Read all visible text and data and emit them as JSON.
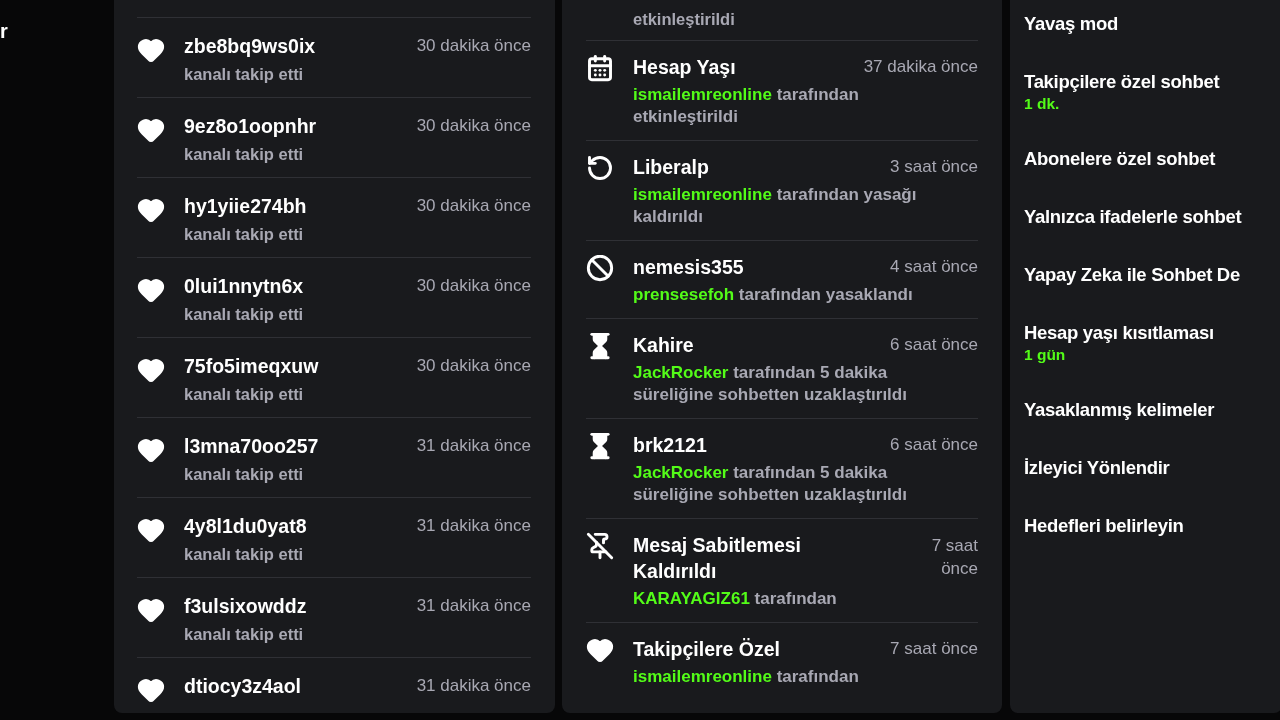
{
  "sidebar_fragment": "r",
  "followers": [
    {
      "name": "zbe8bq9ws0ix",
      "time": "30 dakika önce",
      "action": "kanalı takip etti"
    },
    {
      "name": "9ez8o1oopnhr",
      "time": "30 dakika önce",
      "action": "kanalı takip etti"
    },
    {
      "name": "hy1yiie274bh",
      "time": "30 dakika önce",
      "action": "kanalı takip etti"
    },
    {
      "name": "0lui1nnytn6x",
      "time": "30 dakika önce",
      "action": "kanalı takip etti"
    },
    {
      "name": "75fo5imeqxuw",
      "time": "30 dakika önce",
      "action": "kanalı takip etti"
    },
    {
      "name": "l3mna70oo257",
      "time": "31 dakika önce",
      "action": "kanalı takip etti"
    },
    {
      "name": "4y8l1du0yat8",
      "time": "31 dakika önce",
      "action": "kanalı takip etti"
    },
    {
      "name": "f3ulsixowddz",
      "time": "31 dakika önce",
      "action": "kanalı takip etti"
    },
    {
      "name": "dtiocy3z4aol",
      "time": "31 dakika önce"
    }
  ],
  "mod_log_fragment": "etkinleştirildi",
  "mod_log": [
    {
      "kind": "account_age",
      "title": "Hesap Yaşı",
      "time": "37 dakika önce",
      "actor": "ismailemreonline",
      "text": "tarafından etkinleştirildi"
    },
    {
      "kind": "unban",
      "title": "Liberalp",
      "time": "3 saat önce",
      "actor": "ismailemreonline",
      "text": "tarafından yasağı kaldırıldı"
    },
    {
      "kind": "ban",
      "title": "nemesis355",
      "time": "4 saat önce",
      "actor": "prensesefoh",
      "text": "tarafından yasaklandı"
    },
    {
      "kind": "timeout",
      "title": "Kahire",
      "time": "6 saat önce",
      "actor": "JackRocker",
      "text": "tarafından 5 dakika süreliğine sohbetten uzaklaştırıldı"
    },
    {
      "kind": "timeout",
      "title": "brk2121",
      "time": "6 saat önce",
      "actor": "JackRocker",
      "text": "tarafından 5 dakika süreliğine sohbetten uzaklaştırıldı"
    },
    {
      "kind": "unpin",
      "title": "Mesaj Sabitlemesi Kaldırıldı",
      "time": "7 saat önce",
      "actor": "KARAYAGIZ61",
      "text": "tarafından"
    },
    {
      "kind": "follow",
      "title": "Takipçilere Özel",
      "time": "7 saat önce",
      "actor": "ismailemreonline",
      "text": "tarafından"
    }
  ],
  "chat_settings": [
    {
      "label": "Yavaş mod"
    },
    {
      "label": "Takipçilere özel sohbet",
      "value": "1 dk."
    },
    {
      "label": "Abonelere özel sohbet"
    },
    {
      "label": "Yalnızca ifadelerle sohbet"
    },
    {
      "label": "Yapay Zeka ile Sohbet De"
    },
    {
      "label": "Hesap yaşı kısıtlaması",
      "value": "1 gün"
    },
    {
      "label": "Yasaklanmış kelimeler"
    },
    {
      "label": "İzleyici Yönlendir"
    },
    {
      "label": "Hedefleri belirleyin"
    }
  ]
}
